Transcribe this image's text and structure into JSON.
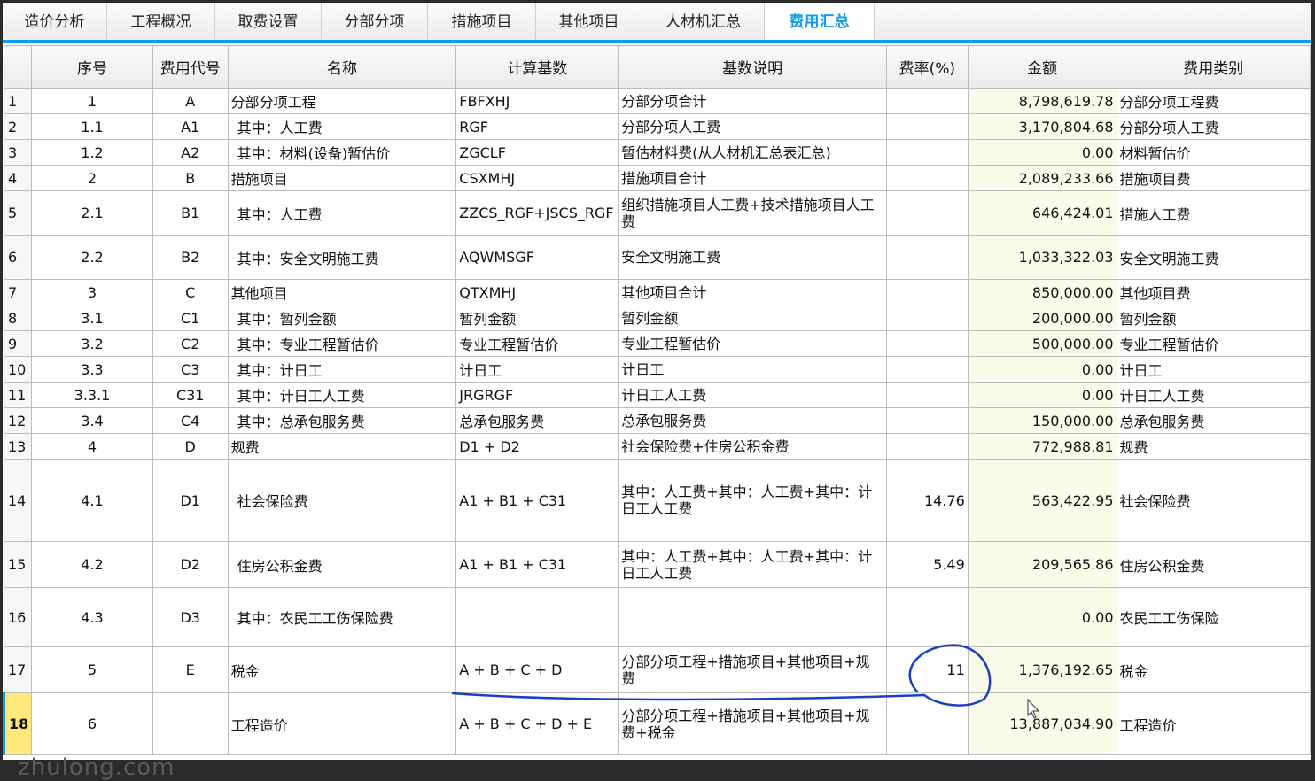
{
  "tabs": [
    {
      "label": "造价分析"
    },
    {
      "label": "工程概况"
    },
    {
      "label": "取费设置"
    },
    {
      "label": "分部分项"
    },
    {
      "label": "措施项目"
    },
    {
      "label": "其他项目"
    },
    {
      "label": "人材机汇总"
    },
    {
      "label": "费用汇总"
    }
  ],
  "active_tab": "费用汇总",
  "columns": [
    "序号",
    "费用代号",
    "名称",
    "计算基数",
    "基数说明",
    "费率(%)",
    "金额",
    "费用类别"
  ],
  "rows": [
    {
      "n": "1",
      "seq": "1",
      "code": "A",
      "name": "分部分项工程",
      "base": "FBFXHJ",
      "desc": "分部分项合计",
      "rate": "",
      "amount": "8,798,619.78",
      "cat": "分部分项工程费"
    },
    {
      "n": "2",
      "seq": "1.1",
      "code": "A1",
      "name": "其中：人工费",
      "base": "RGF",
      "desc": "分部分项人工费",
      "rate": "",
      "amount": "3,170,804.68",
      "cat": "分部分项人工费"
    },
    {
      "n": "3",
      "seq": "1.2",
      "code": "A2",
      "name": "其中：材料(设备)暂估价",
      "base": "ZGCLF",
      "desc": "暂估材料费(从人材机汇总表汇总)",
      "rate": "",
      "amount": "0.00",
      "cat": "材料暂估价"
    },
    {
      "n": "4",
      "seq": "2",
      "code": "B",
      "name": "措施项目",
      "base": "CSXMHJ",
      "desc": "措施项目合计",
      "rate": "",
      "amount": "2,089,233.66",
      "cat": "措施项目费"
    },
    {
      "n": "5",
      "seq": "2.1",
      "code": "B1",
      "name": "其中：人工费",
      "base": "ZZCS_RGF+JSCS_RGF",
      "desc": "组织措施项目人工费+技术措施项目人工费",
      "rate": "",
      "amount": "646,424.01",
      "cat": "措施人工费"
    },
    {
      "n": "6",
      "seq": "2.2",
      "code": "B2",
      "name": "其中：安全文明施工费",
      "base": "AQWMSGF",
      "desc": "安全文明施工费",
      "rate": "",
      "amount": "1,033,322.03",
      "cat": "安全文明施工费"
    },
    {
      "n": "7",
      "seq": "3",
      "code": "C",
      "name": "其他项目",
      "base": "QTXMHJ",
      "desc": "其他项目合计",
      "rate": "",
      "amount": "850,000.00",
      "cat": "其他项目费"
    },
    {
      "n": "8",
      "seq": "3.1",
      "code": "C1",
      "name": "其中：暂列金额",
      "base": "暂列金额",
      "desc": "暂列金额",
      "rate": "",
      "amount": "200,000.00",
      "cat": "暂列金额"
    },
    {
      "n": "9",
      "seq": "3.2",
      "code": "C2",
      "name": "其中：专业工程暂估价",
      "base": "专业工程暂估价",
      "desc": "专业工程暂估价",
      "rate": "",
      "amount": "500,000.00",
      "cat": "专业工程暂估价"
    },
    {
      "n": "10",
      "seq": "3.3",
      "code": "C3",
      "name": "其中：计日工",
      "base": "计日工",
      "desc": "计日工",
      "rate": "",
      "amount": "0.00",
      "cat": "计日工"
    },
    {
      "n": "11",
      "seq": "3.3.1",
      "code": "C31",
      "name": "其中：计日工人工费",
      "base": "JRGRGF",
      "desc": "计日工人工费",
      "rate": "",
      "amount": "0.00",
      "cat": "计日工人工费"
    },
    {
      "n": "12",
      "seq": "3.4",
      "code": "C4",
      "name": "其中：总承包服务费",
      "base": "总承包服务费",
      "desc": "总承包服务费",
      "rate": "",
      "amount": "150,000.00",
      "cat": "总承包服务费"
    },
    {
      "n": "13",
      "seq": "4",
      "code": "D",
      "name": "规费",
      "base": "D1 + D2",
      "desc": "社会保险费+住房公积金费",
      "rate": "",
      "amount": "772,988.81",
      "cat": "规费"
    },
    {
      "n": "14",
      "seq": "4.1",
      "code": "D1",
      "name": "社会保险费",
      "base": "A1 + B1 + C31",
      "desc": "其中：人工费+其中：人工费+其中：计日工人工费",
      "rate": "14.76",
      "amount": "563,422.95",
      "cat": "社会保险费"
    },
    {
      "n": "15",
      "seq": "4.2",
      "code": "D2",
      "name": "住房公积金费",
      "base": "A1 + B1 + C31",
      "desc": "其中：人工费+其中：人工费+其中：计日工人工费",
      "rate": "5.49",
      "amount": "209,565.86",
      "cat": "住房公积金费"
    },
    {
      "n": "16",
      "seq": "4.3",
      "code": "D3",
      "name": "其中：农民工工伤保险费",
      "base": "",
      "desc": "",
      "rate": "",
      "amount": "0.00",
      "cat": "农民工工伤保险"
    },
    {
      "n": "17",
      "seq": "5",
      "code": "E",
      "name": "税金",
      "base": "A + B + C + D",
      "desc": "分部分项工程+措施项目+其他项目+规费",
      "rate": "11",
      "amount": "1,376,192.65",
      "cat": "税金"
    },
    {
      "n": "18",
      "seq": "6",
      "code": "",
      "name": "工程造价",
      "base": "A + B + C + D + E",
      "desc": "分部分项工程+措施项目+其他项目+规费+税金",
      "rate": "",
      "amount": "13,887,034.90",
      "cat": "工程造价"
    }
  ],
  "watermark": "zhulong.com",
  "colors": {
    "accent": "#0f9de8",
    "annotation": "#1a3fc4",
    "amount_bg": "#fbfbe9"
  }
}
